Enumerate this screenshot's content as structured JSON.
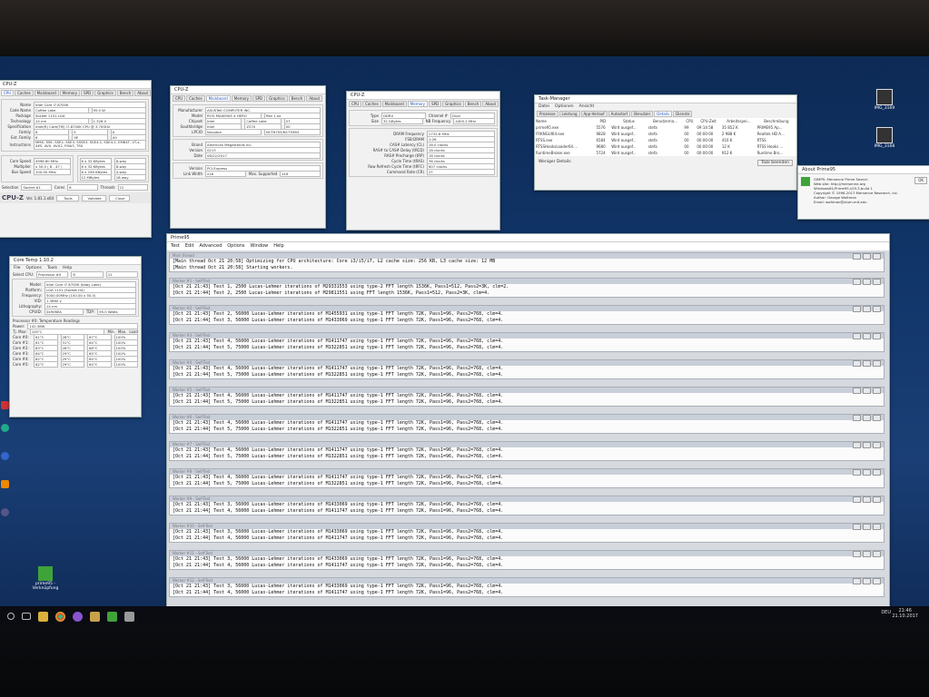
{
  "cpuz_main": {
    "title": "CPU-Z",
    "tabs": [
      "CPU",
      "Caches",
      "Mainboard",
      "Memory",
      "SPD",
      "Graphics",
      "Bench",
      "About"
    ],
    "name": "Intel Core i7 8700K",
    "code_name": "Coffee Lake",
    "max_tdp": "95.0 W",
    "package": "Socket 1151 LGA",
    "technology": "14 nm",
    "core_voltage": "1.328 V",
    "specification": "Intel(R) Core(TM) i7-8700K CPU @ 3.70GHz",
    "family": "6",
    "model": "E",
    "stepping": "A",
    "ext_family": "6",
    "ext_model": "9E",
    "revision": "U0",
    "instructions": "MMX, SSE, SSE2, SSE3, SSSE3, SSE4.1, SSE4.2, EM64T, VT-x, AES, AVX, AVX2, FMA3, TSX",
    "core_speed": "4998.80 MHz",
    "multiplier": "x 50.0 ( 8 - 47 )",
    "bus_speed": "100.00 MHz",
    "l1_data": "6 x 32 KBytes",
    "l1_data_way": "8-way",
    "l1_inst": "6 x 32 KBytes",
    "l1_inst_way": "8-way",
    "level2": "6 x 256 KBytes",
    "level2_way": "4-way",
    "level3": "12 MBytes",
    "level3_way": "16-way",
    "selection": "Socket #1",
    "cores": "6",
    "threads": "12",
    "version": "Ver. 1.81.1.x64",
    "tools_btn": "Tools",
    "validate_btn": "Validate",
    "close_btn": "Close"
  },
  "cpuz_mainboard": {
    "title": "CPU-Z",
    "tabs": [
      "CPU",
      "Caches",
      "Mainboard",
      "Memory",
      "SPD",
      "Graphics",
      "Bench",
      "About"
    ],
    "manufacturer": "ASUSTeK COMPUTER INC.",
    "model": "ROG MAXIMUS X HERO",
    "rev": "Rev 1.xx",
    "chipset": "Intel",
    "chipset_name": "Coffee Lake",
    "chipset_rev": "07",
    "southbridge": "Intel",
    "southbridge_name": "Z370",
    "southbridge_rev": "00",
    "lpcio": "Nuvoton",
    "lpcio_name": "NCT6793/NCT5563",
    "bios_brand": "American Megatrends Inc.",
    "bios_version": "0213",
    "bios_date": "08/22/2017",
    "gi_version": "PCI-Express",
    "link_width": "x16",
    "max_supported": "x16"
  },
  "cpuz_memory": {
    "title": "CPU-Z",
    "tabs": [
      "CPU",
      "Caches",
      "Mainboard",
      "Memory",
      "SPD",
      "Graphics",
      "Bench",
      "About"
    ],
    "type": "DDR4",
    "channel": "Dual",
    "size": "32 GBytes",
    "nb_frequency": "4400.2 MHz",
    "dram_frequency": "1732.6 MHz",
    "fsb_dram": "1:26",
    "cas": "16.0 clocks",
    "trcd": "18 clocks",
    "trp": "18 clocks",
    "tras": "36 clocks",
    "trfc": "607 clocks",
    "cr": "2T"
  },
  "coretemp": {
    "title": "Core Temp 1.10.2",
    "menu": [
      "File",
      "Options",
      "Tools",
      "Help"
    ],
    "select_cpu": "Processor #0",
    "cores": "6",
    "threads": "12",
    "model": "Intel Core i7 8700K (Kaby Lake)",
    "platform": "LGA 1151 (Socket H4)",
    "frequency": "5000.00MHz (100.00 x 50.0)",
    "vid": "1.3660 v",
    "lithography": "14 nm",
    "cpuid": "0x906EA",
    "tdp": "95.0 Watts",
    "readings_label": "Processor #0: Temperature Readings",
    "power": "142.38W",
    "tj_max": "100°C",
    "cores_list": [
      {
        "name": "Core #0:",
        "temp": "61°C",
        "min": "28°C",
        "max": "67°C",
        "load": "100%"
      },
      {
        "name": "Core #1:",
        "temp": "61°C",
        "min": "31°C",
        "max": "64°C",
        "load": "100%"
      },
      {
        "name": "Core #2:",
        "temp": "63°C",
        "min": "28°C",
        "max": "68°C",
        "load": "100%"
      },
      {
        "name": "Core #3:",
        "temp": "64°C",
        "min": "29°C",
        "max": "65°C",
        "load": "100%"
      },
      {
        "name": "Core #4:",
        "temp": "62°C",
        "min": "29°C",
        "max": "64°C",
        "load": "100%"
      },
      {
        "name": "Core #5:",
        "temp": "62°C",
        "min": "29°C",
        "max": "64°C",
        "load": "100%"
      }
    ]
  },
  "taskmgr": {
    "title": "Task-Manager",
    "menu": [
      "Datei",
      "Optionen",
      "Ansicht"
    ],
    "tabs": [
      "Prozesse",
      "Leistung",
      "App-Verlauf",
      "Autostart",
      "Benutzer",
      "Details",
      "Dienste"
    ],
    "headers": [
      "Name",
      "PID",
      "Status",
      "Benutzerna...",
      "CPU",
      "CPU-Zeit",
      "Arbeitsspei...",
      "Beschreibung"
    ],
    "rows": [
      [
        "prime95.exe",
        "5576",
        "Wird ausgef...",
        "stefa",
        "99",
        "09:14:58",
        "35 852 K",
        "PRIME95 Ap..."
      ],
      [
        "FRKNGUI64.exe",
        "9828",
        "Wird ausgef...",
        "stefa",
        "00",
        "00:00:00",
        "2 988 K",
        "Realtek HD A..."
      ],
      [
        "RTSS.exe",
        "6584",
        "Wird ausgef...",
        "stefa",
        "00",
        "00:00:00",
        "416 K",
        "RTSS"
      ],
      [
        "RTSSHooksLoader64....",
        "9680",
        "Wird ausgef...",
        "stefa",
        "00",
        "00:00:00",
        "12 K",
        "RTSS Hooks ..."
      ],
      [
        "RuntimeBroker.exe",
        "5724",
        "Wird ausgef...",
        "stefa",
        "00",
        "00:00:00",
        "912 K",
        "Runtime Bro..."
      ]
    ],
    "fewer_details": "Weniger Details",
    "end_task": "Task beenden"
  },
  "about_prime": {
    "title": "About Prime95",
    "lines": [
      "GIMPS: Mersenne Prime Search",
      "Web site: http://mersenne.org",
      "Windows64,Prime95,v29.3,build 1",
      "Copyright © 1996-2017 Mersenne Research, Inc.",
      "Author: George Woltman",
      "Email: woltman@alum.mit.edu"
    ],
    "ok": "OK"
  },
  "prime95": {
    "title": "Prime95",
    "menu": [
      "Test",
      "Edit",
      "Advanced",
      "Options",
      "Window",
      "Help"
    ],
    "main_thread_title": "Main thread",
    "main_lines": [
      "[Main thread Oct 21 20:58] Optimizing for CPU architecture: Core i3/i5/i7, L2 cache size: 256 KB, L3 cache size: 12 MB",
      "[Main thread Oct 21 20:58] Starting workers."
    ],
    "workers": [
      {
        "title": "Worker #1 - Self-Test",
        "lines": [
          "[Oct 21 21:43] Test 1, 2500 Lucas-Lehmer iterations of M29331553 using type-2 FFT length 1536K, Pass1=512, Pass2=3K, clm=2.",
          "[Oct 21 21:44] Test 2, 2500 Lucas-Lehmer iterations of M29811551 using FFT length 1536K, Pass1=512, Pass2=3K, clm=4."
        ]
      },
      {
        "title": "Worker #2 - Self-Test",
        "lines": [
          "[Oct 21 21:43] Test 2, 56000 Lucas-Lehmer iterations of M1455931 using type-1 FFT length 72K, Pass1=96, Pass2=768, clm=4.",
          "[Oct 21 21:44] Test 3, 56000 Lucas-Lehmer iterations of M1433069 using type-1 FFT length 72K, Pass1=96, Pass2=768, clm=4."
        ]
      },
      {
        "title": "Worker #3 - Self-Test",
        "lines": [
          "[Oct 21 21:43] Test 4, 56000 Lucas-Lehmer iterations of M1411747 using type-1 FFT length 72K, Pass1=96, Pass2=768, clm=4.",
          "[Oct 21 21:44] Test 5, 75000 Lucas-Lehmer iterations of M1322851 using type-1 FFT length 72K, Pass1=96, Pass2=768, clm=4."
        ]
      },
      {
        "title": "Worker #4 - Self-Test",
        "lines": [
          "[Oct 21 21:43] Test 4, 56000 Lucas-Lehmer iterations of M1411747 using type-1 FFT length 72K, Pass1=96, Pass2=768, clm=4.",
          "[Oct 21 21:44] Test 5, 75000 Lucas-Lehmer iterations of M1322851 using type-1 FFT length 72K, Pass1=96, Pass2=768, clm=4."
        ]
      },
      {
        "title": "Worker #5 - Self-Test",
        "lines": [
          "[Oct 21 21:43] Test 4, 56000 Lucas-Lehmer iterations of M1411747 using type-1 FFT length 72K, Pass1=96, Pass2=768, clm=4.",
          "[Oct 21 21:44] Test 5, 75000 Lucas-Lehmer iterations of M1322851 using type-1 FFT length 72K, Pass1=96, Pass2=768, clm=4."
        ]
      },
      {
        "title": "Worker #6 - Self-Test",
        "lines": [
          "[Oct 21 21:43] Test 4, 56000 Lucas-Lehmer iterations of M1411747 using type-1 FFT length 72K, Pass1=96, Pass2=768, clm=4.",
          "[Oct 21 21:44] Test 5, 75000 Lucas-Lehmer iterations of M1322851 using type-1 FFT length 72K, Pass1=96, Pass2=768, clm=4."
        ]
      },
      {
        "title": "Worker #7 - Self-Test",
        "lines": [
          "[Oct 21 21:43] Test 4, 56000 Lucas-Lehmer iterations of M1411747 using type-1 FFT length 72K, Pass1=96, Pass2=768, clm=4.",
          "[Oct 21 21:44] Test 5, 75000 Lucas-Lehmer iterations of M1322851 using type-1 FFT length 72K, Pass1=96, Pass2=768, clm=4."
        ]
      },
      {
        "title": "Worker #8 - Self-Test",
        "lines": [
          "[Oct 21 21:43] Test 4, 56000 Lucas-Lehmer iterations of M1411747 using type-1 FFT length 72K, Pass1=96, Pass2=768, clm=4.",
          "[Oct 21 21:44] Test 5, 75000 Lucas-Lehmer iterations of M1322851 using type-1 FFT length 72K, Pass1=96, Pass2=768, clm=4."
        ]
      },
      {
        "title": "Worker #9 - Self-Test",
        "lines": [
          "[Oct 21 21:43] Test 3, 56000 Lucas-Lehmer iterations of M1433069 using type-1 FFT length 72K, Pass1=96, Pass2=768, clm=4.",
          "[Oct 21 21:44] Test 4, 56000 Lucas-Lehmer iterations of M1411747 using type-1 FFT length 72K, Pass1=96, Pass2=768, clm=4."
        ]
      },
      {
        "title": "Worker #10 - Self-Test",
        "lines": [
          "[Oct 21 21:43] Test 3, 56000 Lucas-Lehmer iterations of M1433069 using type-1 FFT length 72K, Pass1=96, Pass2=768, clm=4.",
          "[Oct 21 21:44] Test 4, 56000 Lucas-Lehmer iterations of M1411747 using type-1 FFT length 72K, Pass1=96, Pass2=768, clm=4."
        ]
      },
      {
        "title": "Worker #11 - Self-Test",
        "lines": [
          "[Oct 21 21:43] Test 3, 56000 Lucas-Lehmer iterations of M1433069 using type-1 FFT length 72K, Pass1=96, Pass2=768, clm=4.",
          "[Oct 21 21:44] Test 4, 56000 Lucas-Lehmer iterations of M1411747 using type-1 FFT length 72K, Pass1=96, Pass2=768, clm=4."
        ]
      },
      {
        "title": "Worker #12 - Self-Test",
        "lines": [
          "[Oct 21 21:43] Test 3, 56000 Lucas-Lehmer iterations of M1433069 using type-1 FFT length 72K, Pass1=96, Pass2=768, clm=4.",
          "[Oct 21 21:44] Test 4, 56000 Lucas-Lehmer iterations of M1411747 using type-1 FFT length 72K, Pass1=96, Pass2=768, clm=4."
        ]
      }
    ]
  },
  "desktop_icons": {
    "right1": "IMG_3169",
    "right2": "IMG_3168",
    "prime_shortcut": "prime95 - Verknüpfung"
  },
  "clock": {
    "time": "21:46",
    "date": "21.10.2017",
    "lang": "DEU"
  }
}
